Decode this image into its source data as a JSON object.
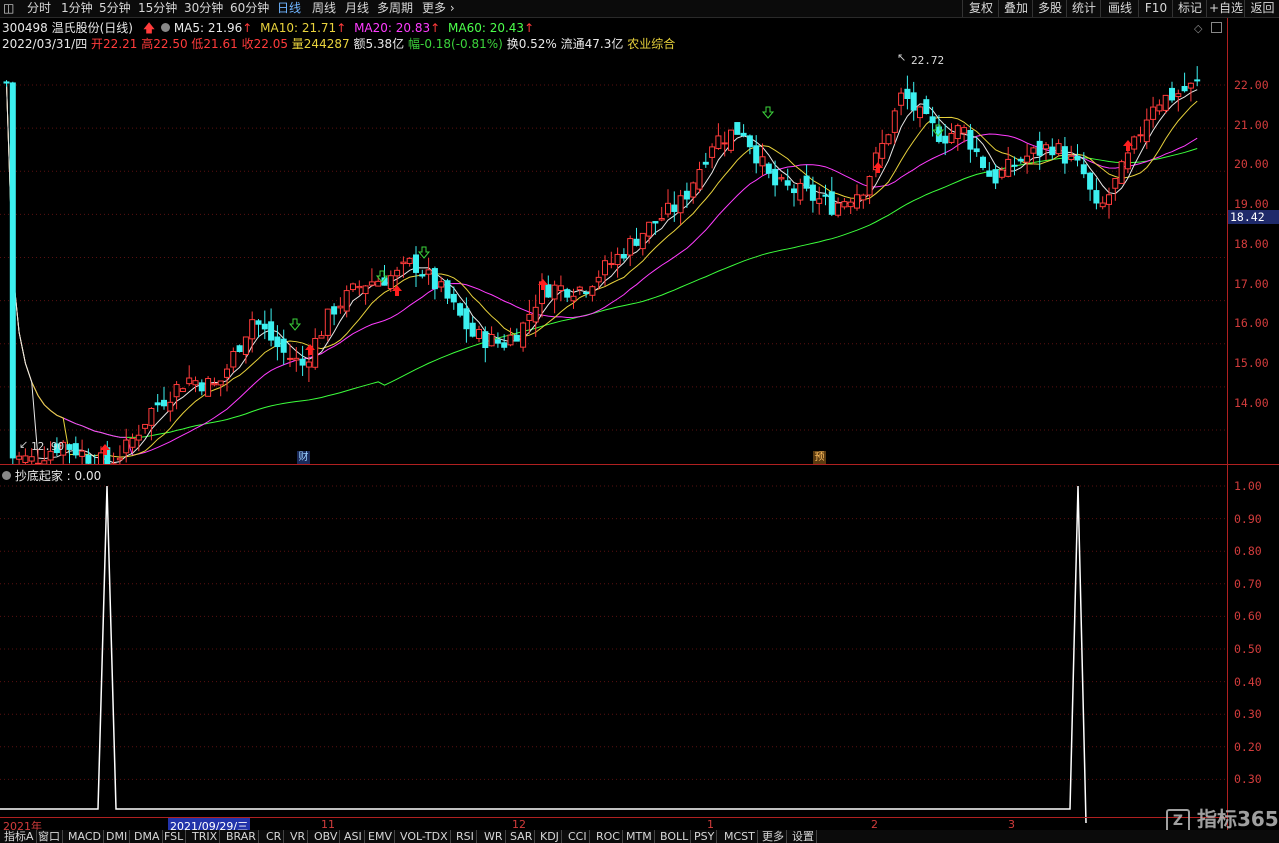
{
  "toolbar": {
    "periods": [
      "分时",
      "1分钟",
      "5分钟",
      "15分钟",
      "30分钟",
      "60分钟",
      "日线",
      "周线",
      "月线",
      "多周期",
      "更多"
    ],
    "active_period": "日线",
    "right_buttons": [
      "复权",
      "叠加",
      "多股",
      "统计",
      "画线",
      "F10",
      "标记",
      "+自选",
      "返回"
    ]
  },
  "header": {
    "code_name": "300498 温氏股份(日线)",
    "ma5_label": "MA5: 21.96",
    "ma10_label": "MA10: 21.71",
    "ma20_label": "MA20: 20.83",
    "ma60_label": "MA60: 20.43",
    "date": "2022/03/31/四",
    "open": "开22.21",
    "high": "高22.50",
    "low": "低21.61",
    "close": "收22.05",
    "volume": "量244287",
    "amount": "额5.38亿",
    "change": "幅-0.18(-0.81%)",
    "turnover": "换0.52%",
    "float_cap": "流通47.3亿",
    "sector": "农业综合"
  },
  "main_chart": {
    "price_ticks": [
      "22.00",
      "21.00",
      "20.00",
      "19.00",
      "18.00",
      "17.00",
      "16.00",
      "15.00",
      "14.00"
    ],
    "current_price": "18.42",
    "max_marker": "22.72",
    "min_marker": "12.90",
    "event_markers": [
      "财",
      "预"
    ],
    "colors": {
      "up": "#ff3b3b",
      "down": "#3cf0f0",
      "ma5": "#e8e8e8",
      "ma10": "#e8d23c",
      "ma20": "#ff3cff",
      "ma60": "#3cff3c",
      "grid": "#5a1010"
    }
  },
  "indicator": {
    "title": "抄底起家 : 0.00",
    "ticks": [
      "1.00",
      "0.90",
      "0.80",
      "0.70",
      "0.60",
      "0.50",
      "0.40",
      "0.30",
      "0.20",
      "0.30"
    ]
  },
  "time_axis": {
    "labels": [
      "2021年",
      "2021/09/29/三",
      "11",
      "12",
      "1",
      "2",
      "3"
    ]
  },
  "bottom_tabs": [
    "指标A",
    "窗口",
    "MACD",
    "DMI",
    "DMA",
    "FSL",
    "TRIX",
    "BRAR",
    "CR",
    "VR",
    "OBV",
    "ASI",
    "EMV",
    "VOL-TDX",
    "RSI",
    "WR",
    "SAR",
    "KDJ",
    "CCI",
    "ROC",
    "MTM",
    "BOLL",
    "PSY",
    "MCST",
    "更多",
    "设置"
  ],
  "watermark": "指标365"
}
